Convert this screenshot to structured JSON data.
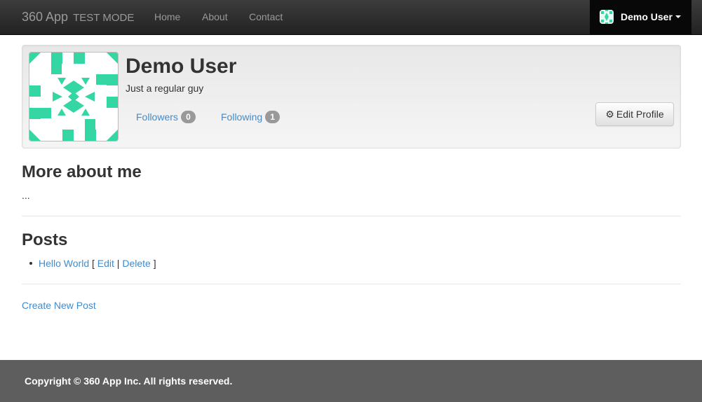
{
  "navbar": {
    "brand": "360 App",
    "mode": "TEST MODE",
    "links": [
      "Home",
      "About",
      "Contact"
    ],
    "user_name": "Demo User"
  },
  "profile": {
    "name": "Demo User",
    "tagline": "Just a regular guy",
    "followers_label": "Followers",
    "followers_count": "0",
    "following_label": "Following",
    "following_count": "1",
    "edit_button": "Edit Profile"
  },
  "about": {
    "title": "More about me",
    "text": "..."
  },
  "posts": {
    "title": "Posts",
    "items": [
      {
        "title": "Hello World",
        "edit": "Edit",
        "delete": "Delete"
      }
    ],
    "create_link": "Create New Post"
  },
  "footer": {
    "text": "Copyright © 360 App Inc. All rights reserved."
  },
  "colors": {
    "identicon": "#34d6a3",
    "link": "#428bca",
    "footer_bg": "#5e5e5e"
  }
}
